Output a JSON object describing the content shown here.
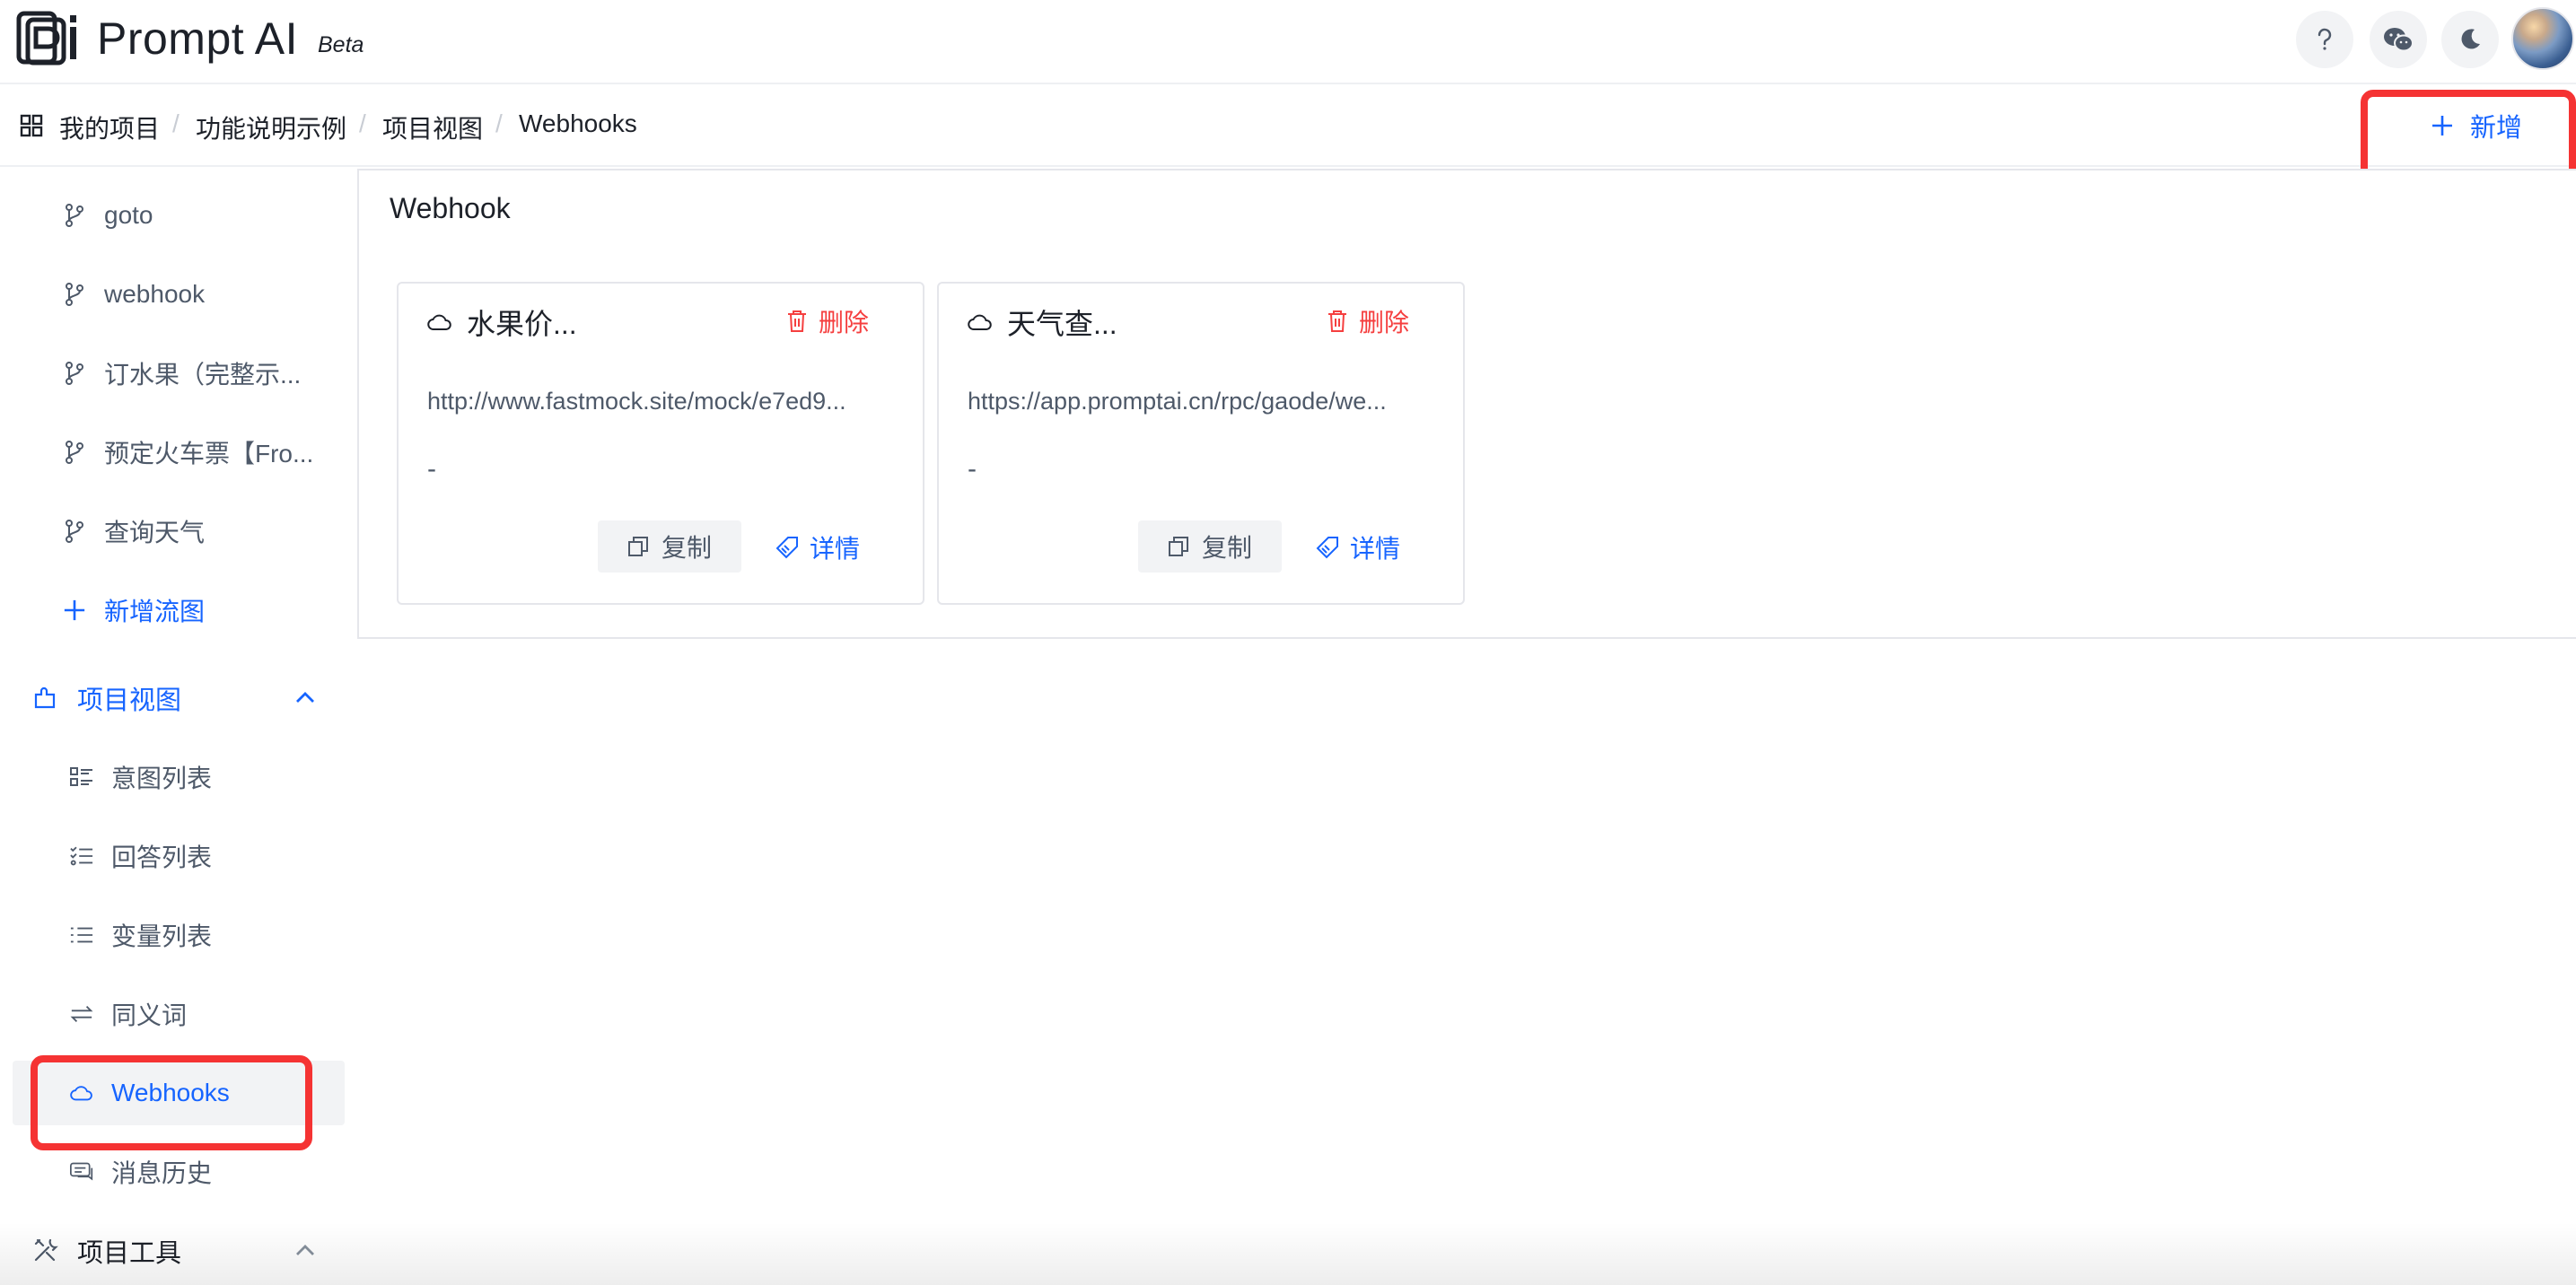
{
  "header": {
    "logo_text": "Prompt AI",
    "beta_label": "Beta",
    "buttons": [
      "help-icon",
      "wechat-icon",
      "moon-icon"
    ]
  },
  "breadcrumb": {
    "items": [
      "我的项目",
      "功能说明示例",
      "项目视图",
      "Webhooks"
    ],
    "separator": "/"
  },
  "toolbar": {
    "add_label": "新增"
  },
  "sidebar": {
    "flows": [
      {
        "label": "goto",
        "icon": "branch-icon"
      },
      {
        "label": "webhook",
        "icon": "branch-icon"
      },
      {
        "label": "订水果（完整示...",
        "icon": "branch-icon"
      },
      {
        "label": "预定火车票【Fro...",
        "icon": "branch-icon"
      },
      {
        "label": "查询天气",
        "icon": "branch-icon"
      }
    ],
    "add_flow_label": "新增流图",
    "project_view": {
      "label": "项目视图",
      "items": [
        {
          "label": "意图列表",
          "icon": "intent-list-icon"
        },
        {
          "label": "回答列表",
          "icon": "answer-list-icon"
        },
        {
          "label": "变量列表",
          "icon": "variable-list-icon"
        },
        {
          "label": "同义词",
          "icon": "swap-icon"
        },
        {
          "label": "Webhooks",
          "icon": "cloud-icon",
          "active": true
        },
        {
          "label": "消息历史",
          "icon": "message-icon"
        }
      ]
    },
    "project_tools": {
      "label": "项目工具"
    }
  },
  "main": {
    "title": "Webhook",
    "cards": [
      {
        "name": "水果价...",
        "url": "http://www.fastmock.site/mock/e7ed9...",
        "description": "-",
        "delete_label": "删除",
        "copy_label": "复制",
        "detail_label": "详情"
      },
      {
        "name": "天气查...",
        "url": "https://app.promptai.cn/rpc/gaode/we...",
        "description": "-",
        "delete_label": "删除",
        "copy_label": "复制",
        "detail_label": "详情"
      }
    ]
  },
  "colors": {
    "accent": "#1664ff",
    "danger": "#f53f3f",
    "highlight": "#f53333",
    "text": "#1d2129",
    "secondary_text": "#4e5969"
  }
}
